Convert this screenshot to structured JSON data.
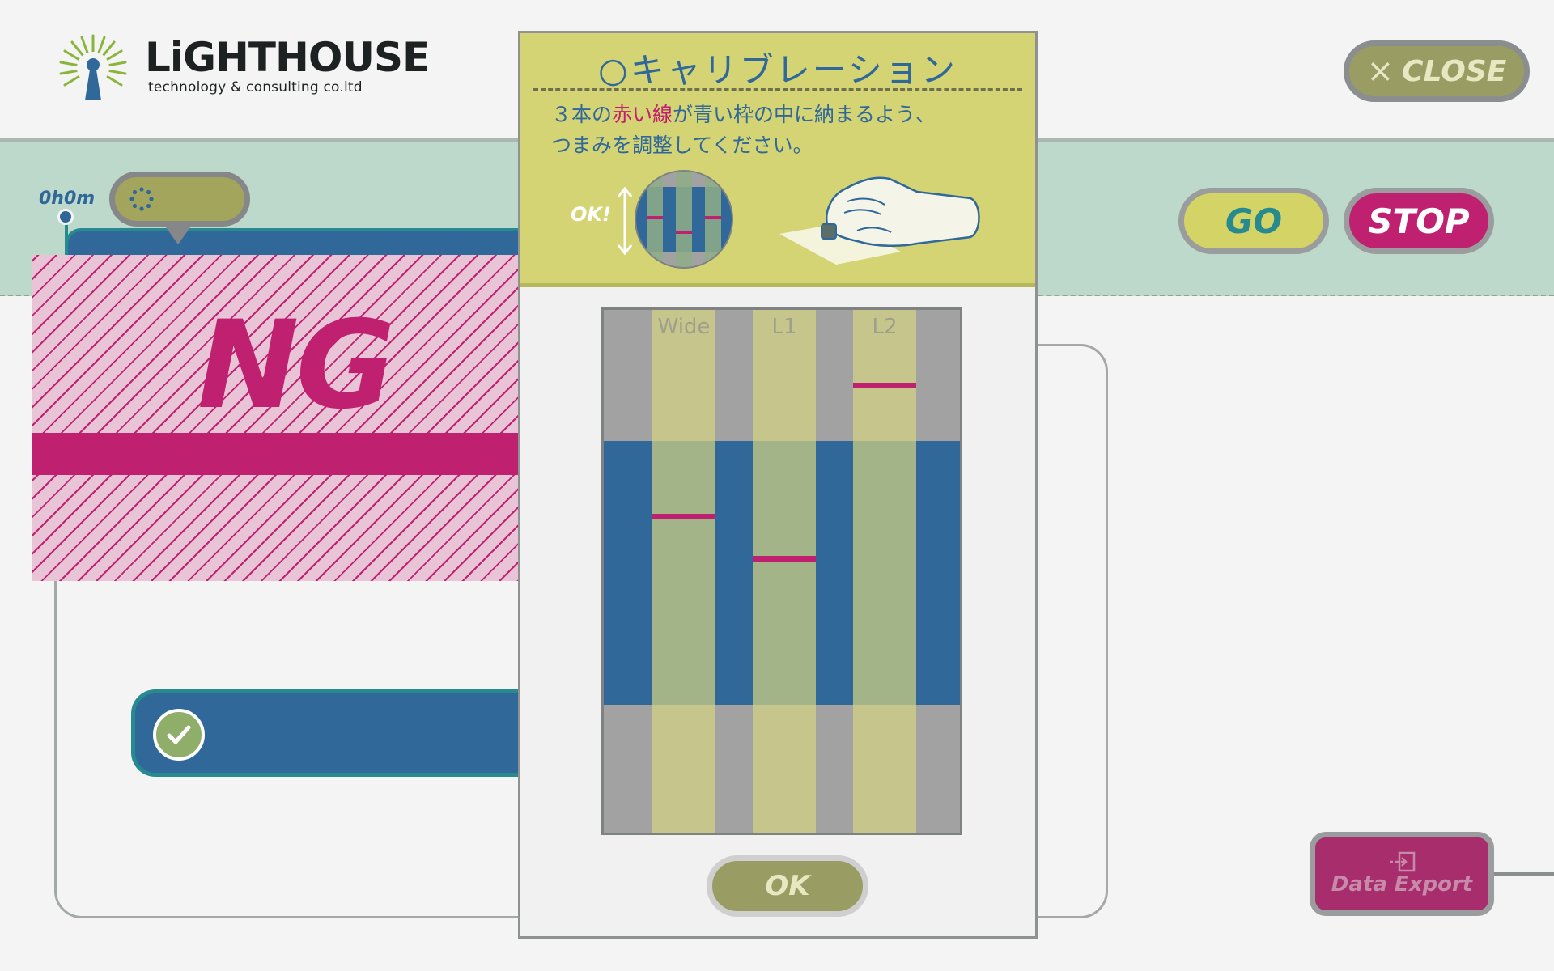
{
  "header": {
    "logo_title": "LiGHTHOUSE",
    "logo_subtitle": "technology & consulting co.ltd",
    "close_label": "CLOSE"
  },
  "control": {
    "timer": "0h0m",
    "go_label": "GO",
    "stop_label": "STOP"
  },
  "status": {
    "result": "NG",
    "check_state": "ok"
  },
  "export": {
    "label": "Data Export"
  },
  "modal": {
    "title": "○キャリブレーション",
    "instruction_pre": "３本の",
    "instruction_red": "赤い線",
    "instruction_post": "が青い枠の中に納まるよう、",
    "instruction_line2": "つまみを調整してください。",
    "hint_label": "OK!",
    "ok_label": "OK",
    "channels": [
      {
        "label": "Wide",
        "marker_fraction": 0.39
      },
      {
        "label": "L1",
        "marker_fraction": 0.47
      },
      {
        "label": "L2",
        "marker_fraction": 0.14
      }
    ]
  },
  "colors": {
    "accent_magenta": "#c02070",
    "accent_blue": "#31689a",
    "accent_yellow": "#d4d474",
    "band_green": "#bcd9cb"
  }
}
